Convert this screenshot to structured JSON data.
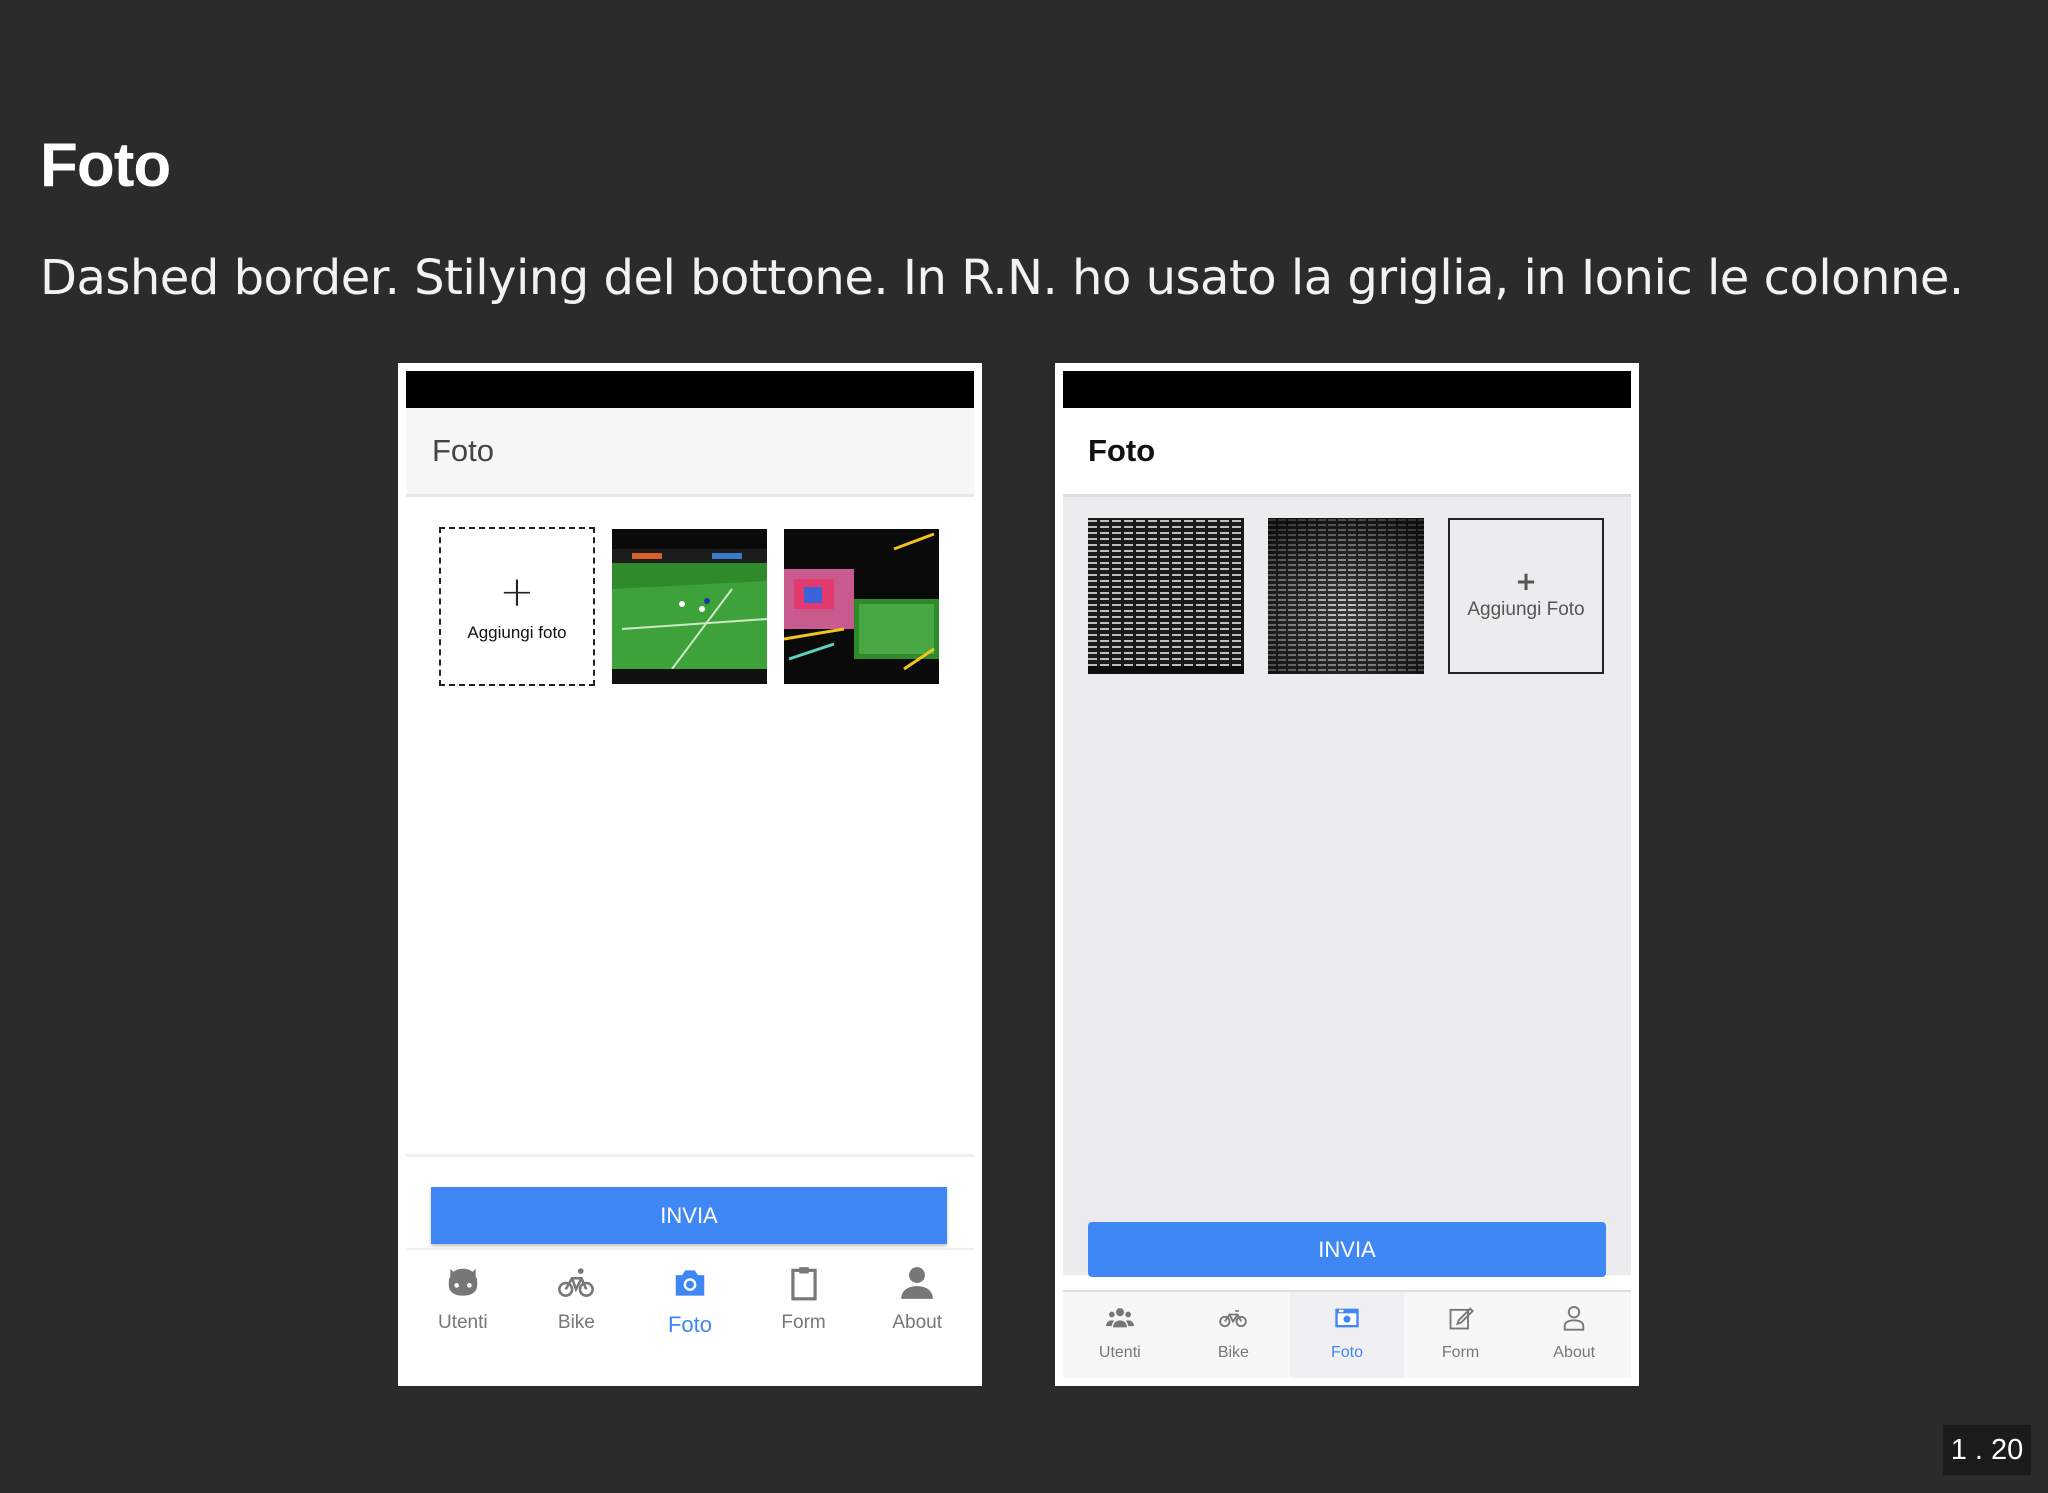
{
  "slide": {
    "title": "Foto",
    "subtitle": "Dashed border. Stilying del bottone. In R.N. ho usato la griglia, in Ionic le colonne.",
    "page_number": "1 . 20"
  },
  "rn_screen": {
    "header_title": "Foto",
    "add_photo_plus": "+",
    "add_photo_label": "Aggiungi foto",
    "submit_label": "INVIA",
    "tabs": [
      {
        "label": "Utenti",
        "icon": "github-icon"
      },
      {
        "label": "Bike",
        "icon": "bike-icon"
      },
      {
        "label": "Foto",
        "icon": "camera-icon",
        "active": true
      },
      {
        "label": "Form",
        "icon": "clipboard-icon"
      },
      {
        "label": "About",
        "icon": "user-icon"
      }
    ]
  },
  "ionic_screen": {
    "header_title": "Foto",
    "add_photo_plus": "+",
    "add_photo_label": "Aggiungi Foto",
    "submit_label": "INVIA",
    "tabs": [
      {
        "label": "Utenti",
        "icon": "people-icon"
      },
      {
        "label": "Bike",
        "icon": "bike-icon"
      },
      {
        "label": "Foto",
        "icon": "image-icon",
        "active": true
      },
      {
        "label": "Form",
        "icon": "edit-icon"
      },
      {
        "label": "About",
        "icon": "user-outline-icon"
      }
    ]
  },
  "colors": {
    "background": "#2b2b2c",
    "accent": "#3f87f4",
    "tab_inactive": "#777777"
  }
}
